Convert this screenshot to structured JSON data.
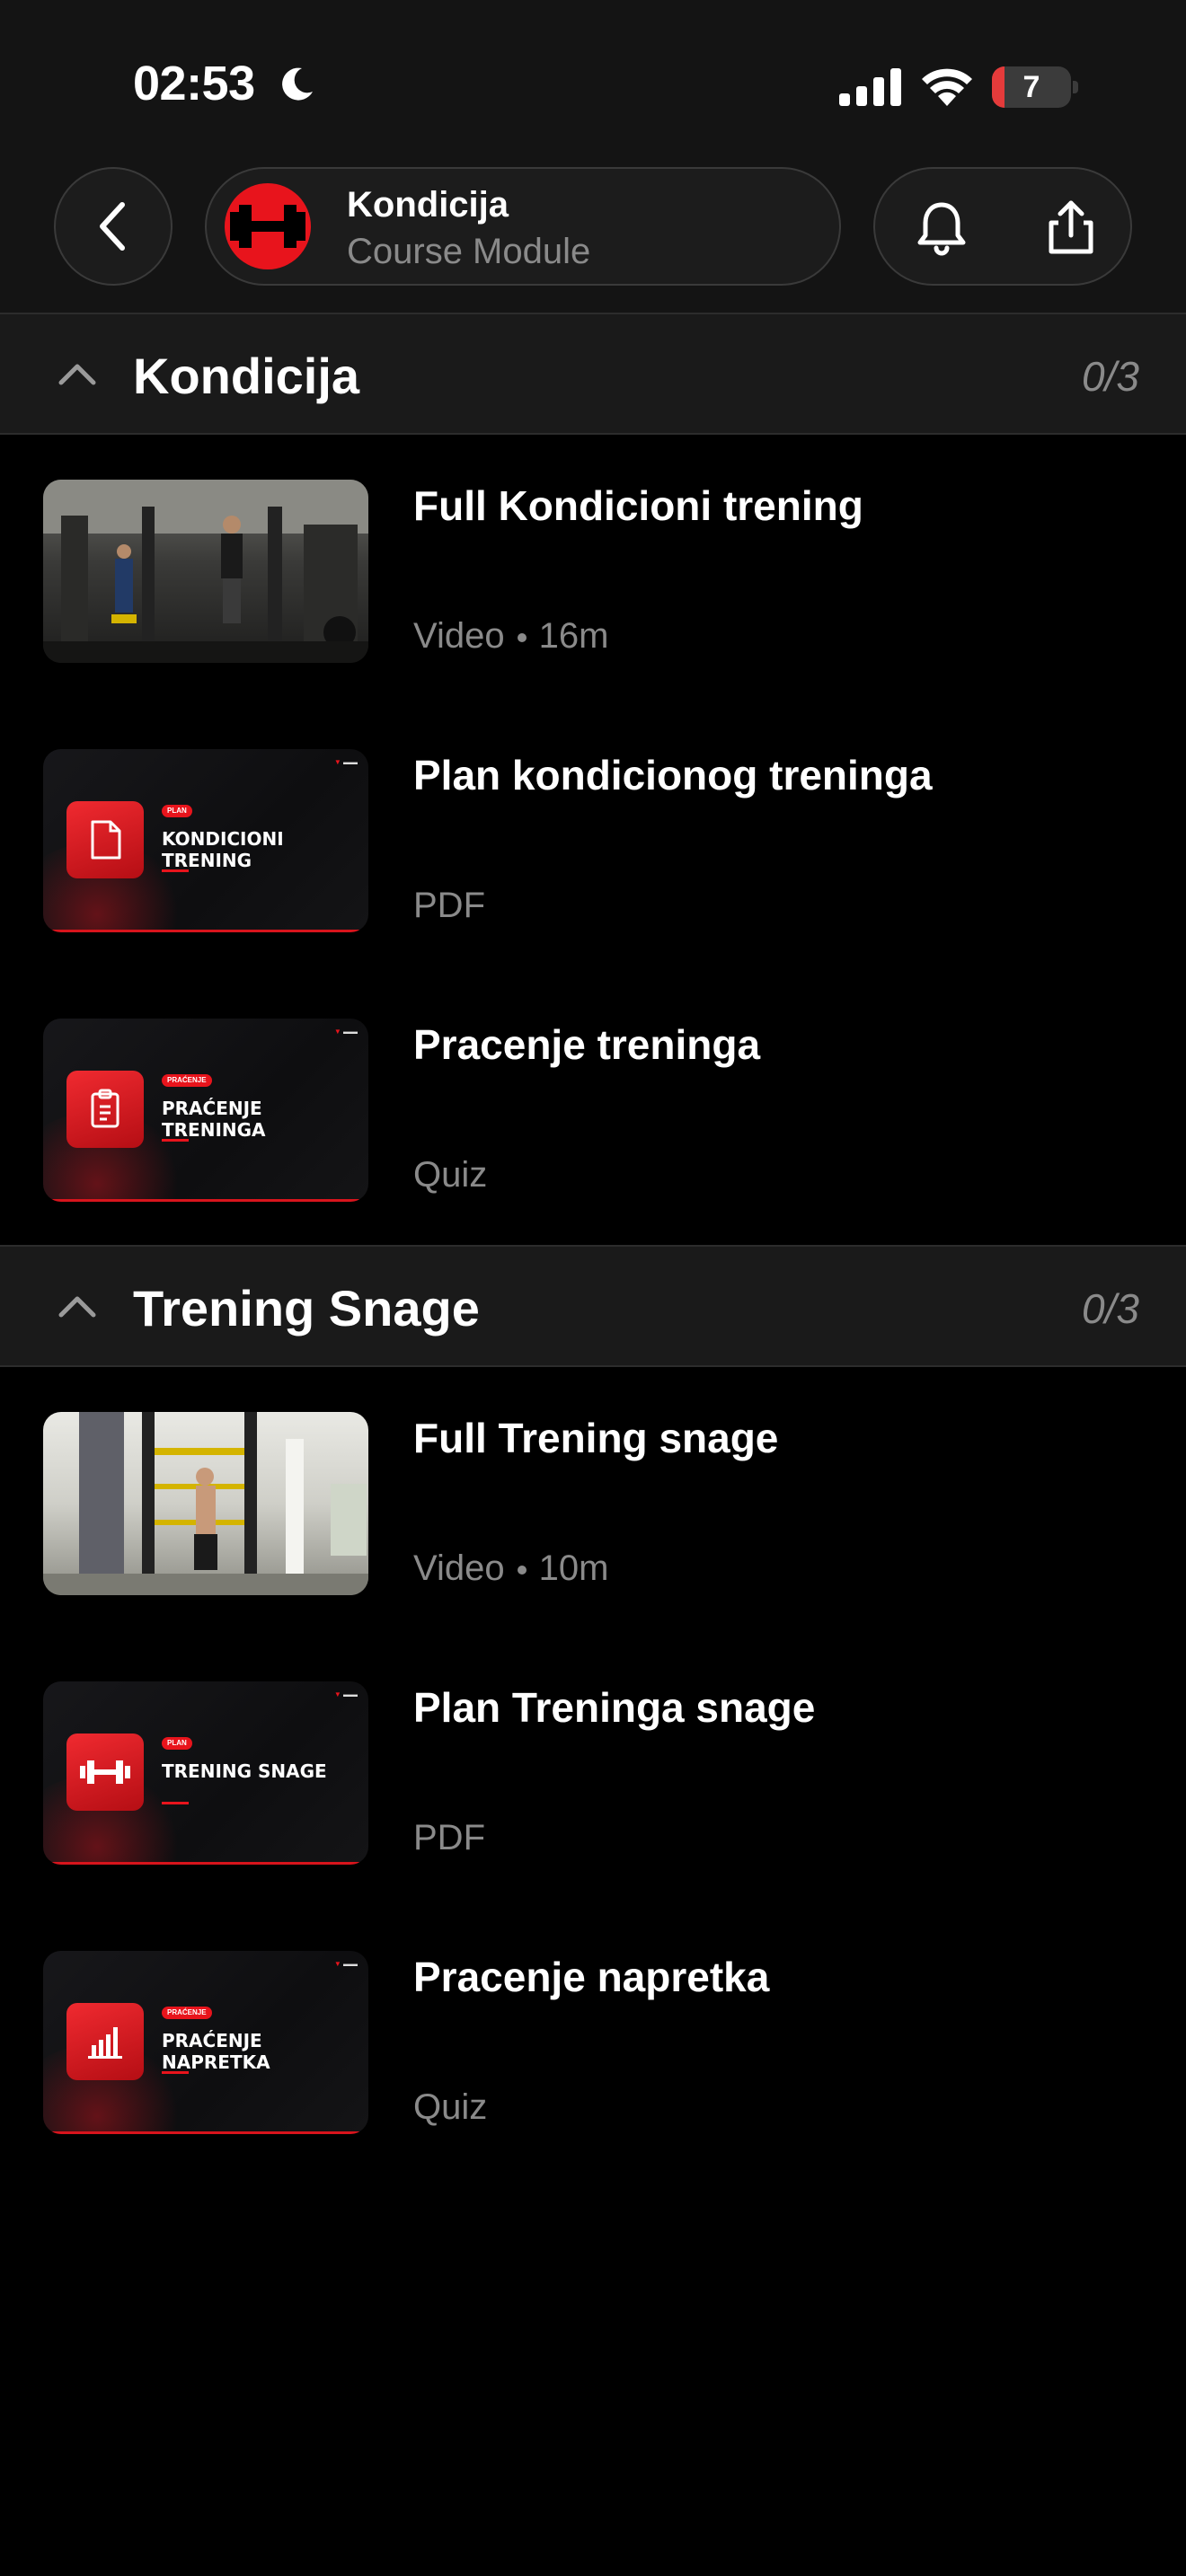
{
  "status_bar": {
    "time": "02:53",
    "battery": "7",
    "battery_level": 0.07
  },
  "header": {
    "title": "Kondicija",
    "subtitle": "Course Module"
  },
  "sections": [
    {
      "title": "Kondicija",
      "progress": "0/3",
      "items": [
        {
          "title": "Full Kondicioni trening",
          "type": "Video",
          "duration": "16m"
        },
        {
          "title": "Plan kondicionog treninga",
          "type": "PDF",
          "thumb_tag": "PLAN",
          "thumb_label": "KONDICIONI TRENING"
        },
        {
          "title": "Pracenje treninga",
          "type": "Quiz",
          "thumb_tag": "PRAĆENJE",
          "thumb_label": "PRAĆENJE TRENINGA"
        }
      ]
    },
    {
      "title": "Trening Snage",
      "progress": "0/3",
      "items": [
        {
          "title": "Full Trening snage",
          "type": "Video",
          "duration": "10m"
        },
        {
          "title": "Plan Treninga snage",
          "type": "PDF",
          "thumb_tag": "PLAN",
          "thumb_label": "TRENING SNAGE"
        },
        {
          "title": "Pracenje napretka",
          "type": "Quiz",
          "thumb_tag": "PRAĆENJE",
          "thumb_label": "PRAĆENJE NAPRETKA"
        }
      ]
    }
  ],
  "icons": {
    "back": "chevron-left-icon",
    "logo": "dumbbell-icon",
    "notifications": "bell-icon",
    "share": "share-icon",
    "collapse": "chevron-up-icon"
  },
  "colors": {
    "accent": "#e8141c",
    "background": "#000000",
    "header_bg": "#141414",
    "muted_text": "#8a8a8a"
  }
}
